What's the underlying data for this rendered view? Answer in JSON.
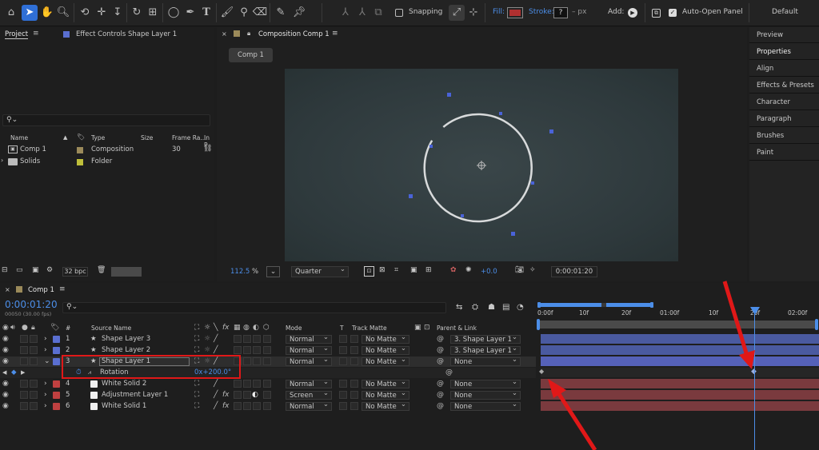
{
  "toolbar": {
    "snapping_label": "Snapping",
    "fill_label": "Fill:",
    "stroke_label": "Stroke:",
    "stroke_value": "?",
    "stroke_unit": "– px",
    "add_label": "Add:",
    "auto_open_label": "Auto-Open Panel",
    "workspace_label": "Default",
    "fill_color": "#b03030"
  },
  "project": {
    "tab_label": "Project",
    "effect_controls_label": "Effect Controls Shape Layer 1",
    "search_placeholder": "",
    "columns": [
      "Name",
      "Type",
      "Size",
      "Frame Ra...",
      "In P"
    ],
    "items": [
      {
        "name": "Comp 1",
        "type": "Composition",
        "size": "",
        "frame_rate": "30",
        "color": "#9b8a5a"
      },
      {
        "name": "Solids",
        "type": "Folder",
        "size": "",
        "frame_rate": "",
        "color": "#bfbf3a"
      }
    ],
    "bpc_label": "32 bpc"
  },
  "composition": {
    "tab_label": "Composition Comp 1",
    "breadcrumb": "Comp 1",
    "zoom_value": "112.5",
    "zoom_unit": "%",
    "resolution": "Quarter",
    "exposure_value": "+0.0",
    "timecode": "0:00:01:20"
  },
  "right_panel": {
    "items": [
      "Preview",
      "Properties",
      "Align",
      "Effects & Presets",
      "Character",
      "Paragraph",
      "Brushes",
      "Paint"
    ]
  },
  "timeline": {
    "tab_label": "Comp 1",
    "timecode": "0:00:01:20",
    "frames_info": "00050 (30.00 fps)",
    "ruler_labels": [
      "0:00f",
      "10f",
      "20f",
      "01:00f",
      "10f",
      "20f",
      "02:00f"
    ],
    "headers": {
      "source_name": "Source Name",
      "mode": "Mode",
      "t": "T",
      "track_matte": "Track Matte",
      "parent_link": "Parent & Link"
    },
    "layers": [
      {
        "num": "1",
        "name": "Shape Layer 3",
        "mode": "Normal",
        "matte": "No Matte",
        "parent": "3. Shape Layer 1",
        "color": "#5a6fd0",
        "bar": "#4a5aa0"
      },
      {
        "num": "2",
        "name": "Shape Layer 2",
        "mode": "Normal",
        "matte": "No Matte",
        "parent": "3. Shape Layer 1",
        "color": "#5a6fd0",
        "bar": "#4a5aa0"
      },
      {
        "num": "3",
        "name": "Shape Layer 1",
        "mode": "Normal",
        "matte": "No Matte",
        "parent": "None",
        "color": "#5a6fd0",
        "bar": "#5561b8"
      },
      {
        "num": "4",
        "name": "White Solid 2",
        "mode": "Normal",
        "matte": "No Matte",
        "parent": "None",
        "color": "#c04040",
        "bar": "#7a3a3e"
      },
      {
        "num": "5",
        "name": "Adjustment Layer 1",
        "mode": "Screen",
        "matte": "No Matte",
        "parent": "None",
        "color": "#c04040",
        "bar": "#7a3a3e"
      },
      {
        "num": "6",
        "name": "White Solid 1",
        "mode": "Normal",
        "matte": "No Matte",
        "parent": "None",
        "color": "#c04040",
        "bar": "#7a3a3e"
      }
    ],
    "rotation": {
      "label": "Rotation",
      "value": "0x+200.0°"
    }
  },
  "colors": {
    "accent": "#2f6fd6",
    "annotation": "#e01818"
  }
}
